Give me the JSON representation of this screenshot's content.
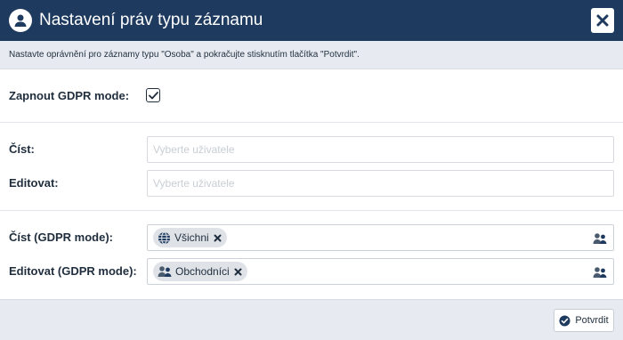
{
  "dialog": {
    "title": "Nastavení práv typu záznamu",
    "info": "Nastavte oprávnění pro záznamy typu \"Osoba\" a pokračujte stisknutím tlačítka \"Potvrdit\"."
  },
  "form": {
    "gdpr_mode_label": "Zapnout GDPR mode:",
    "gdpr_mode_checked": true,
    "read_label": "Číst:",
    "read_placeholder": "Vyberte uživatele",
    "edit_label": "Editovat:",
    "edit_placeholder": "Vyberte uživatele",
    "read_gdpr_label": "Číst (GDPR mode):",
    "read_gdpr_tags": [
      {
        "label": "Všichni",
        "icon": "globe-icon"
      }
    ],
    "edit_gdpr_label": "Editovat (GDPR mode):",
    "edit_gdpr_tags": [
      {
        "label": "Obchodníci",
        "icon": "users-icon"
      }
    ]
  },
  "footer": {
    "confirm_label": "Potvrdit"
  },
  "colors": {
    "header_bg": "#1f3a5f",
    "bar_bg": "#e7ebf1",
    "tag_bg": "#dfe3e8",
    "text": "#1f2d3d"
  }
}
